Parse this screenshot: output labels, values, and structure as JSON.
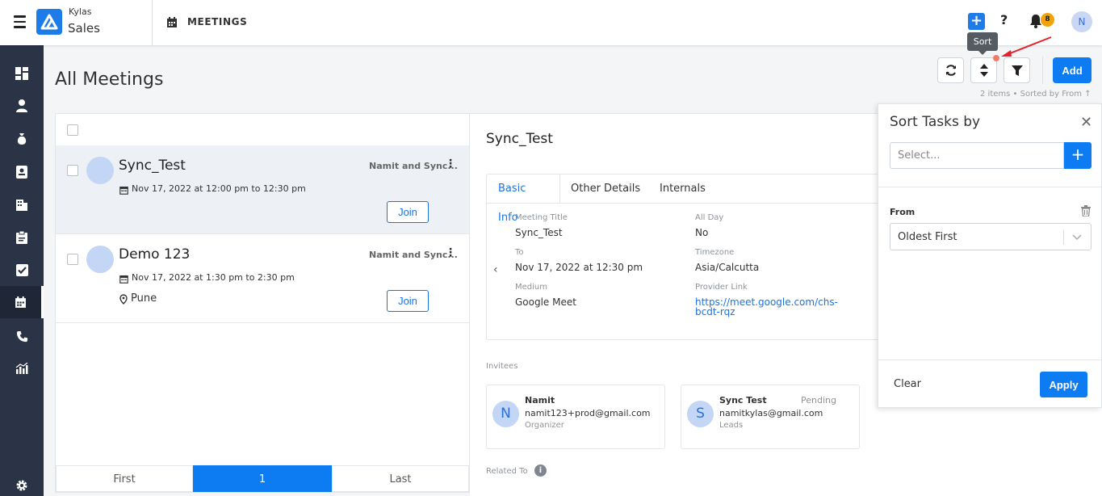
{
  "app": {
    "brand_top": "Kylas",
    "brand_bottom": "Sales",
    "module": "MEETINGS"
  },
  "header": {
    "notifications_count": "8",
    "user_initial": "N"
  },
  "page": {
    "title": "All Meetings",
    "add_label": "Add",
    "items_info": "2 items • Sorted by From ↑",
    "tooltip": "Sort"
  },
  "meetings": [
    {
      "title": "Sync_Test",
      "date": "Nov 17, 2022 at 12:00 pm to 12:30 pm",
      "owner": "Namit and Sync...",
      "join": "Join",
      "location": ""
    },
    {
      "title": "Demo 123",
      "date": "Nov 17, 2022 at 1:30 pm to 2:30 pm",
      "owner": "Namit and Sync...",
      "join": "Join",
      "location": "Pune"
    }
  ],
  "pager": {
    "first": "First",
    "current": "1",
    "last": "Last"
  },
  "detail": {
    "title": "Sync_Test",
    "tabs": [
      "Basic Info",
      "Other Details",
      "Internals"
    ],
    "fields": {
      "meeting_title_label": "Meeting Title",
      "meeting_title": "Sync_Test",
      "all_day_label": "All Day",
      "all_day": "No",
      "to_label": "To",
      "to": "Nov 17, 2022 at 12:30 pm",
      "timezone_label": "Timezone",
      "timezone": "Asia/Calcutta",
      "medium_label": "Medium",
      "medium": "Google Meet",
      "provider_link_label": "Provider Link",
      "provider_link": "https://meet.google.com/chs-bcdt-rqz"
    },
    "invitees_label": "Invitees",
    "invitees": [
      {
        "initial": "N",
        "name": "Namit",
        "email": "namit123+prod@gmail.com",
        "role": "Organizer",
        "status": ""
      },
      {
        "initial": "S",
        "name": "Sync Test",
        "email": "namitkylas@gmail.com",
        "role": "Leads",
        "status": "Pending"
      }
    ],
    "related_to_label": "Related To"
  },
  "sort_panel": {
    "title": "Sort Tasks by",
    "select_placeholder": "Select...",
    "field_label": "From",
    "field_value": "Oldest First",
    "clear": "Clear",
    "apply": "Apply"
  },
  "colors": {
    "primary": "#0d7cf2",
    "sidebar": "#2b3446",
    "badge": "#f0a30a"
  }
}
